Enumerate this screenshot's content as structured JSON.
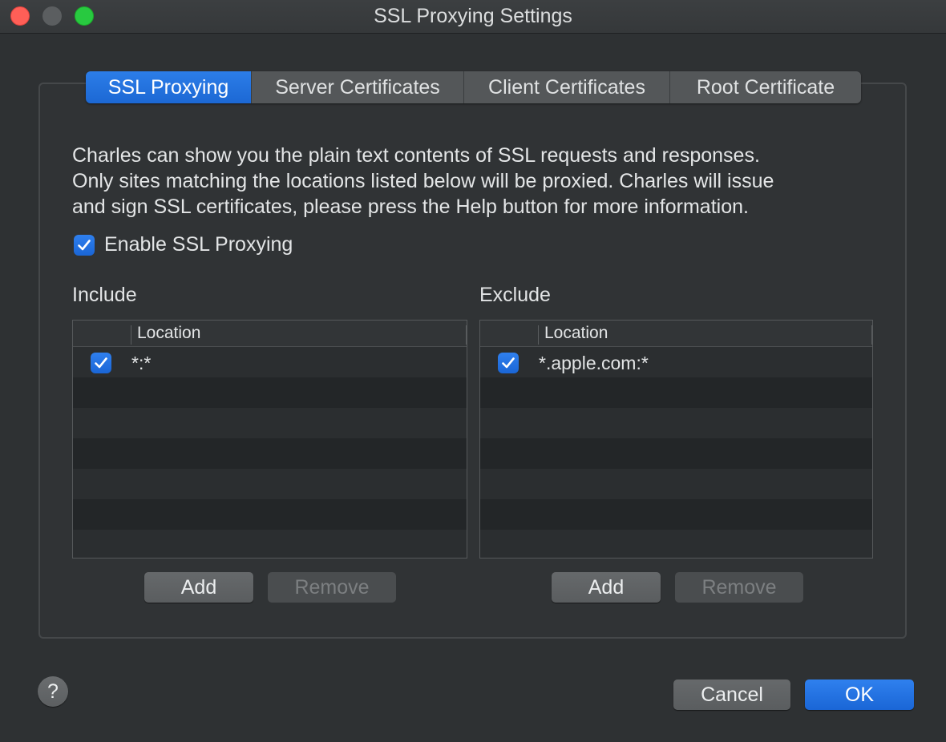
{
  "window": {
    "title": "SSL Proxying Settings"
  },
  "tabs": [
    {
      "label": "SSL Proxying",
      "active": true
    },
    {
      "label": "Server Certificates",
      "active": false
    },
    {
      "label": "Client Certificates",
      "active": false
    },
    {
      "label": "Root Certificate",
      "active": false
    }
  ],
  "description": {
    "lines": [
      "Charles can show you the plain text contents of SSL requests and responses.",
      "Only sites matching the locations listed below will be proxied. Charles will issue",
      "and sign SSL certificates, please press the Help button for more information."
    ]
  },
  "enable_ssl": {
    "label": "Enable SSL Proxying",
    "checked": true
  },
  "include": {
    "label": "Include",
    "column_header": "Location",
    "rows": [
      {
        "checked": true,
        "location": "*:*"
      }
    ],
    "add_label": "Add",
    "remove_label": "Remove"
  },
  "exclude": {
    "label": "Exclude",
    "column_header": "Location",
    "rows": [
      {
        "checked": true,
        "location": "*.apple.com:*"
      }
    ],
    "add_label": "Add",
    "remove_label": "Remove"
  },
  "footer": {
    "help_label": "?",
    "cancel_label": "Cancel",
    "ok_label": "OK"
  },
  "colors": {
    "accent": "#1c68d4",
    "background": "#2e3133",
    "close": "#ff5f57",
    "zoom": "#28c940"
  },
  "icons": {
    "checkbox_checked": "checkmark-icon",
    "help": "question-mark-icon"
  }
}
